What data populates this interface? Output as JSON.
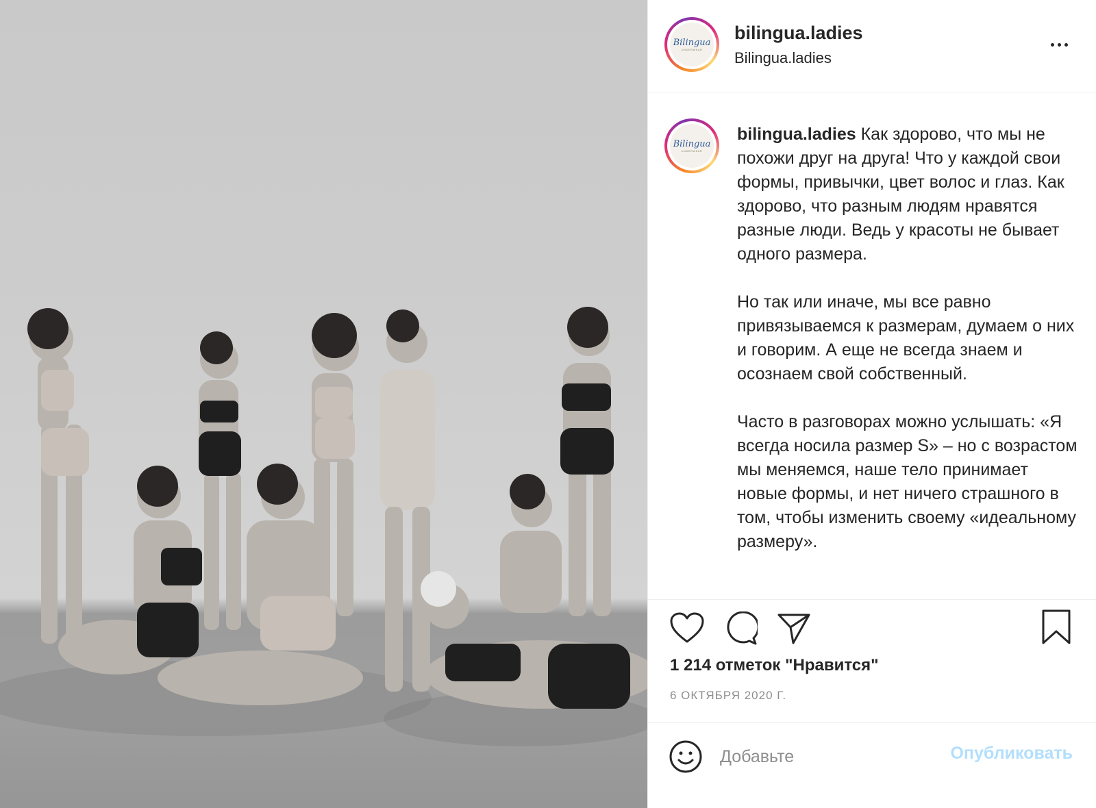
{
  "header": {
    "username": "bilingua.ladies",
    "subtitle": "Bilingua.ladies",
    "more_icon": "more-horizontal-icon"
  },
  "avatar": {
    "logo_text": "Bilingua",
    "logo_sub": "UNDERWEAR"
  },
  "caption": {
    "username": "bilingua.ladies",
    "text": " Как здорово, что мы не похожи друг на друга! Что у каждой свои формы, привычки, цвет волос и глаз. Как здорово, что разным людям нравятся разные люди. Ведь у красоты не бывает одного размера.\n\nНо так или иначе, мы все равно привязываемся к размерам, думаем о них и говорим. А еще не всегда знаем и осознаем свой собственный.\n\nЧасто в разговорах можно услышать: «Я всегда носила размер S» – но с возрастом мы меняемся, наше тело принимает новые формы, и нет ничего страшного в том, чтобы изменить своему «идеальному размеру»."
  },
  "actions": {
    "icons": [
      "heart-icon",
      "comment-icon",
      "share-icon",
      "bookmark-icon"
    ],
    "likes": "1 214 отметок \"Нравится\"",
    "date": "6 ОКТЯБРЯ 2020 Г."
  },
  "comment_box": {
    "placeholder": "Добавьте",
    "publish_label": "Опубликовать",
    "emoji_icon": "smiley-icon"
  },
  "colors": {
    "text": "#262626",
    "secondary": "#8e8e8e",
    "divider": "#efefef",
    "publish_disabled": "#b2dffc"
  }
}
